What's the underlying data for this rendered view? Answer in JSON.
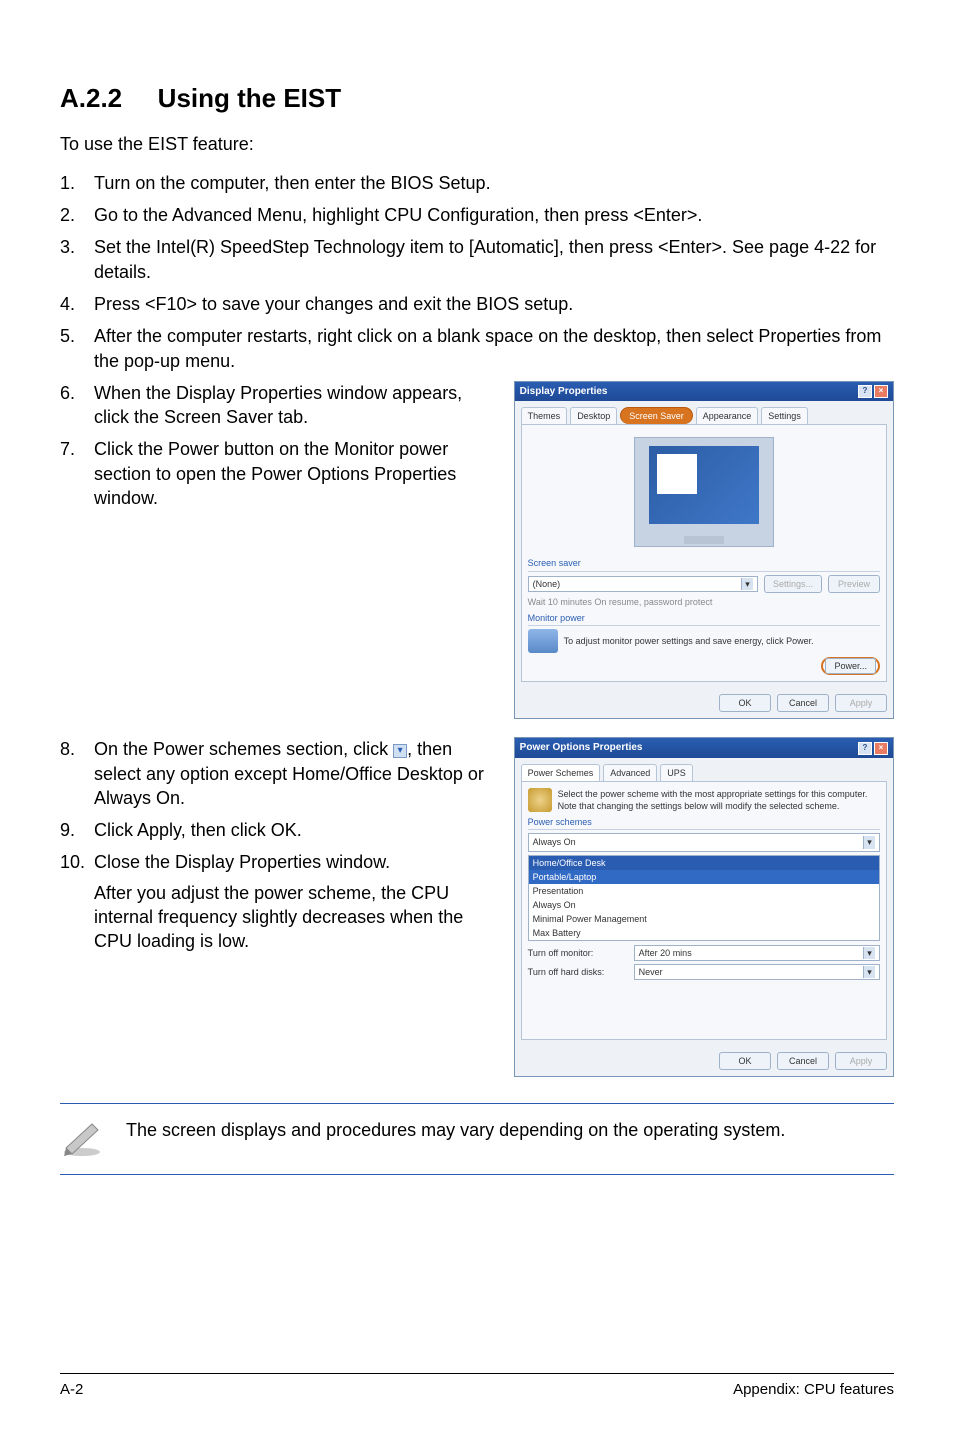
{
  "heading": {
    "num": "A.2.2",
    "title": "Using the EIST"
  },
  "intro": "To use the EIST feature:",
  "steps": {
    "s1": {
      "n": "1.",
      "t": "Turn on the computer, then enter the BIOS Setup."
    },
    "s2": {
      "n": "2.",
      "t": "Go to the Advanced Menu, highlight CPU Configuration, then press <Enter>."
    },
    "s3": {
      "n": "3.",
      "t": "Set the Intel(R) SpeedStep Technology item to [Automatic], then press <Enter>. See page 4-22 for details."
    },
    "s4": {
      "n": "4.",
      "t": "Press <F10> to save your changes and exit the BIOS setup."
    },
    "s5": {
      "n": "5.",
      "t": "After the computer restarts, right click on a blank space on the desktop, then select Properties from the pop-up menu."
    },
    "s6": {
      "n": "6.",
      "t": "When the Display Properties window appears, click the Screen Saver tab."
    },
    "s7": {
      "n": "7.",
      "t": "Click the Power button on the Monitor power section to open the Power Options Properties window."
    },
    "s8a": "On the Power schemes section, click ",
    "s8b": ", then select any option except Home/Office Desktop or Always On.",
    "s8n": "8.",
    "s9": {
      "n": "9.",
      "t": "Click Apply, then click OK."
    },
    "s10": {
      "n": "10.",
      "t": "Close the Display Properties window."
    },
    "s10_sub": "After you adjust the power scheme, the CPU internal frequency slightly decreases when the CPU loading is low."
  },
  "note": "The screen displays and procedures may vary depending on the operating system.",
  "footer": {
    "left": "A-2",
    "right": "Appendix: CPU features"
  },
  "display_props": {
    "title": "Display Properties",
    "tabs": {
      "t1": "Themes",
      "t2": "Desktop",
      "t3": "Screen Saver",
      "t4": "Appearance",
      "t5": "Settings"
    },
    "screensaver_hdr": "Screen saver",
    "ss_none": "(None)",
    "settings_btn": "Settings...",
    "preview_btn": "Preview",
    "wait_row": "Wait      10    minutes    On resume, password protect",
    "monitor_hdr": "Monitor power",
    "monitor_txt": "To adjust monitor power settings and save energy, click Power.",
    "power_btn": "Power...",
    "ok": "OK",
    "cancel": "Cancel",
    "apply": "Apply"
  },
  "power_opts": {
    "title": "Power Options Properties",
    "tabs": {
      "t1": "Power Schemes",
      "t2": "Advanced",
      "t3": "UPS"
    },
    "desc": "Select the power scheme with the most appropriate settings for this computer. Note that changing the settings below will modify the selected scheme.",
    "schemes_hdr": "Power schemes",
    "sel_top": "Always On",
    "dd": {
      "d1": "Home/Office Desk",
      "d2": "Portable/Laptop",
      "d3": "Presentation",
      "d4": "Always On",
      "d5": "Minimal Power Management",
      "d6": "Max Battery"
    },
    "turnoff_mon_lbl": "Turn off monitor:",
    "turnoff_mon_val": "After 20 mins",
    "turnoff_hd_lbl": "Turn off hard disks:",
    "turnoff_hd_val": "Never",
    "ok": "OK",
    "cancel": "Cancel",
    "apply": "Apply"
  }
}
